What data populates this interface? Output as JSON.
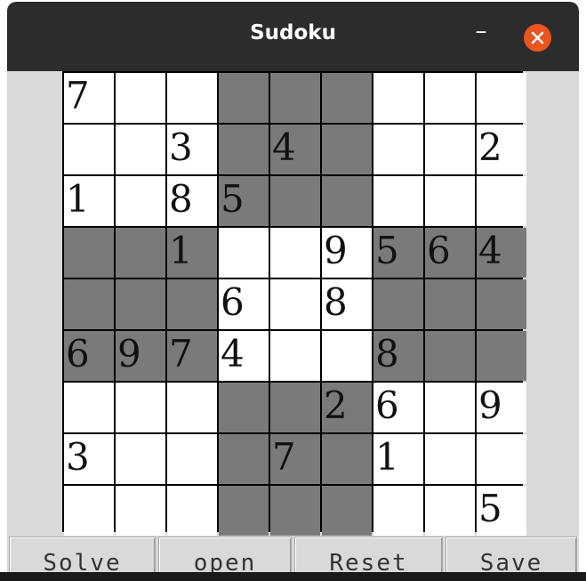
{
  "window": {
    "title": "Sudoku",
    "minimize_label": "–"
  },
  "colors": {
    "titlebar": "#2c2c2c",
    "close": "#e95420",
    "cell_light": "#ffffff",
    "cell_dark": "#7a7a7a",
    "grid": "#000000"
  },
  "board": {
    "rows": [
      [
        "7",
        "",
        "",
        "",
        "",
        "",
        "",
        "",
        ""
      ],
      [
        "",
        "",
        "3",
        "",
        "4",
        "",
        "",
        "",
        "2"
      ],
      [
        "1",
        "",
        "8",
        "5",
        "",
        "",
        "",
        "",
        ""
      ],
      [
        "",
        "",
        "1",
        "",
        "",
        "9",
        "5",
        "6",
        "4"
      ],
      [
        "",
        "",
        "",
        "6",
        "",
        "8",
        "",
        "",
        ""
      ],
      [
        "6",
        "9",
        "7",
        "4",
        "",
        "",
        "8",
        "",
        ""
      ],
      [
        "",
        "",
        "",
        "",
        "",
        "2",
        "6",
        "",
        "9"
      ],
      [
        "3",
        "",
        "",
        "",
        "7",
        "",
        "1",
        "",
        ""
      ],
      [
        "",
        "",
        "",
        "",
        "",
        "",
        "",
        "",
        "5"
      ]
    ],
    "shading": [
      [
        "L",
        "L",
        "L",
        "D",
        "D",
        "D",
        "L",
        "L",
        "L"
      ],
      [
        "L",
        "L",
        "L",
        "D",
        "D",
        "D",
        "L",
        "L",
        "L"
      ],
      [
        "L",
        "L",
        "L",
        "D",
        "D",
        "D",
        "L",
        "L",
        "L"
      ],
      [
        "D",
        "D",
        "D",
        "L",
        "L",
        "L",
        "D",
        "D",
        "D"
      ],
      [
        "D",
        "D",
        "D",
        "L",
        "L",
        "L",
        "D",
        "D",
        "D"
      ],
      [
        "D",
        "D",
        "D",
        "L",
        "L",
        "L",
        "D",
        "D",
        "D"
      ],
      [
        "L",
        "L",
        "L",
        "D",
        "D",
        "D",
        "L",
        "L",
        "L"
      ],
      [
        "L",
        "L",
        "L",
        "D",
        "D",
        "D",
        "L",
        "L",
        "L"
      ],
      [
        "L",
        "L",
        "L",
        "D",
        "D",
        "D",
        "L",
        "L",
        "L"
      ]
    ]
  },
  "buttons": {
    "solve": "Solve",
    "open": "open",
    "reset": "Reset",
    "save": "Save"
  }
}
